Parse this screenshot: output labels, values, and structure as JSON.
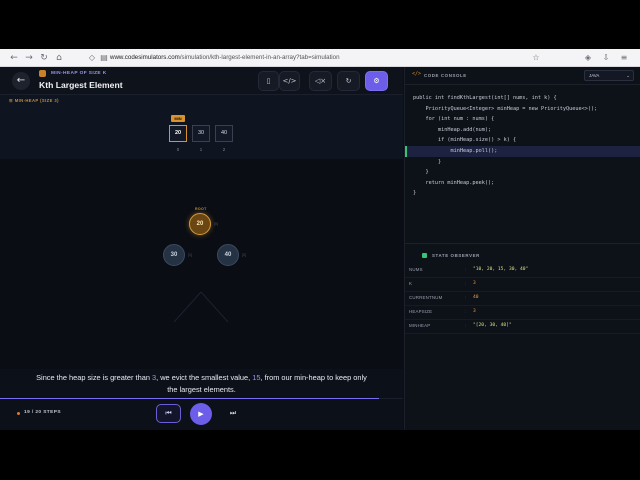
{
  "browser": {
    "url_host": "www.codesimulators.com",
    "url_path": "/simulation/kth-largest-element-in-an-array?tab=simulation",
    "nav": {
      "back": "←",
      "forward": "→",
      "reload": "↻",
      "home": "⌂"
    },
    "icons": [
      "shield-icon",
      "page-icon",
      "star-icon",
      "shield-check-icon",
      "download-icon",
      "menu-icon"
    ]
  },
  "header": {
    "subtitle": "MIN-HEAP OF SIZE K",
    "title": "Kth Largest Element",
    "back_glyph": "←",
    "buttons": {
      "book": "▯",
      "code": "</>",
      "mute": "◁×",
      "reset": "↻",
      "settings": "⚙"
    }
  },
  "viz": {
    "label": "☰ MIN-HEAP (SIZE 3)",
    "min_badge": "MIN",
    "array": [
      {
        "value": "20",
        "index": "0",
        "is_min": true
      },
      {
        "value": "30",
        "index": "1",
        "is_min": false
      },
      {
        "value": "40",
        "index": "2",
        "is_min": false
      }
    ],
    "tree": {
      "root_tag": "ROOT",
      "nodes": [
        {
          "value": "20",
          "index": "[0]",
          "style": "gold"
        },
        {
          "value": "30",
          "index": "[1]",
          "style": "slate"
        },
        {
          "value": "40",
          "index": "[2]",
          "style": "slate"
        }
      ]
    }
  },
  "description": {
    "part1": "Since the heap size is greater than ",
    "k_value": "3",
    "part2": ", we evict the smallest value, ",
    "evicted_value": "15",
    "part3": ", from our min-heap to keep only the largest elements."
  },
  "footer": {
    "step_text": "19 / 20 STEPS",
    "progress": 0.94,
    "prev_glyph": "⏮",
    "play_glyph": "▶",
    "next_glyph": "⏭"
  },
  "console": {
    "icon": "</>",
    "title": "CODE CONSOLE",
    "language": "JAVA",
    "lang_chevron": "⌄",
    "lines": [
      "public int findKthLargest(int[] nums, int k) {",
      "    PriorityQueue<Integer> minHeap = new PriorityQueue<>();",
      "    for (int num : nums) {",
      "        minHeap.add(num);",
      "        if (minHeap.size() > k) {",
      "            minHeap.poll();",
      "        }",
      "    }",
      "    return minHeap.peek();",
      "}"
    ],
    "active_line": 5
  },
  "state": {
    "title": "STATE OBSERVER",
    "rows": [
      {
        "key": "NUMS",
        "value": "\"10, 20, 15, 30, 40\"",
        "kind": "str"
      },
      {
        "key": "K",
        "value": "3",
        "kind": "num"
      },
      {
        "key": "CURRENTNUM",
        "value": "40",
        "kind": "num"
      },
      {
        "key": "HEAPSIZE",
        "value": "3",
        "kind": "num"
      },
      {
        "key": "MINHEAP",
        "value": "\"[20, 30, 40]\"",
        "kind": "str"
      }
    ]
  },
  "colors": {
    "accent": "#6c5ee8",
    "min_gold": "#d8922f",
    "active_line": "#39c27a"
  }
}
